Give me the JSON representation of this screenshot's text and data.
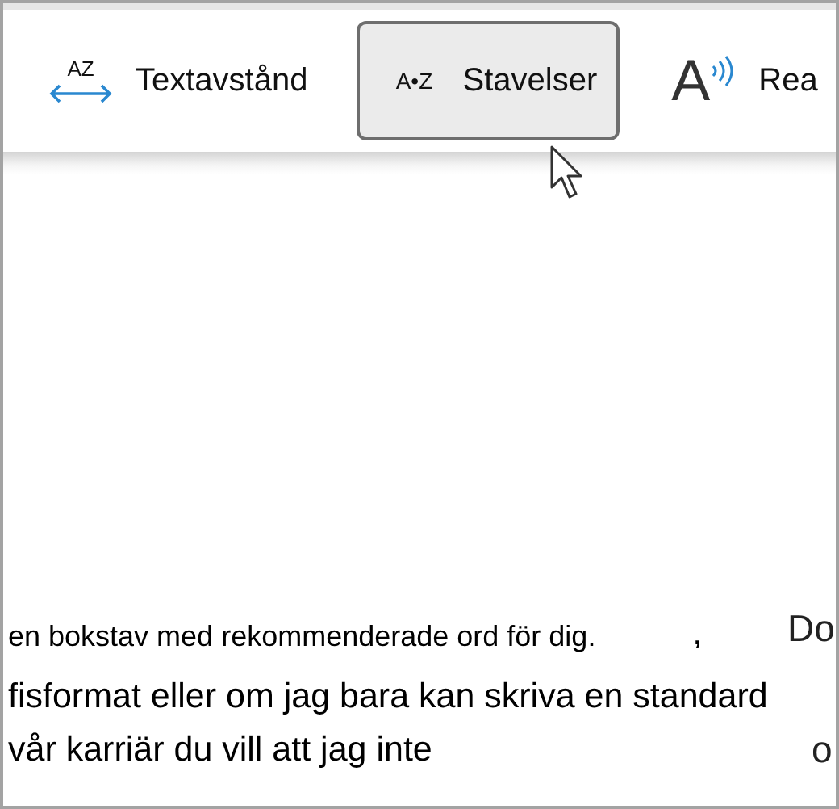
{
  "toolbar": {
    "items": [
      {
        "kind": "spacing",
        "icon_text": "AZ",
        "label": "Textavstånd",
        "selected": false
      },
      {
        "kind": "syllables",
        "icon_text": "A•Z",
        "label": "Stavelser",
        "selected": true
      },
      {
        "kind": "read",
        "icon_text": "A",
        "label": "Rea",
        "selected": false
      }
    ]
  },
  "document": {
    "lines": [
      {
        "kind": "small",
        "text": "en bokstav med rekommenderade ord för dig."
      },
      {
        "kind": "large",
        "text": "fisformat eller om jag bara kan skriva en standard"
      },
      {
        "kind": "large",
        "text": "vår karriär du vill att jag inte"
      }
    ],
    "mark": ",",
    "side_text": [
      "Do",
      "o"
    ]
  }
}
